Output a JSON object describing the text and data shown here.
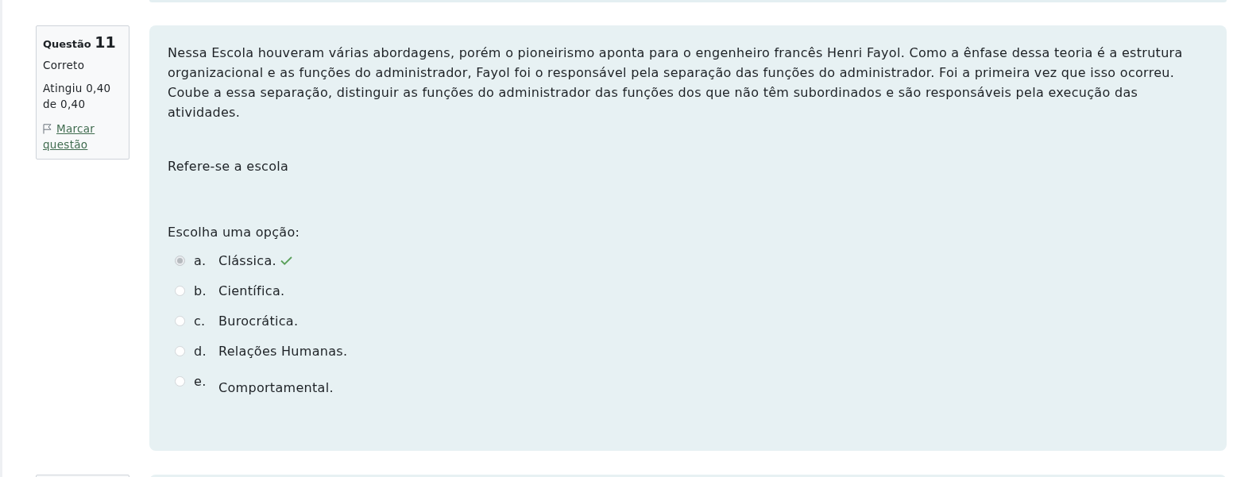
{
  "question": {
    "label": "Questão",
    "number": "11",
    "status": "Correto",
    "grade": "Atingiu 0,40 de 0,40",
    "flag_link": "Marcar questão"
  },
  "question_text": [
    "Nessa Escola houveram várias abordagens, porém o pioneirismo aponta para o engenheiro francês Henri Fayol. Como a ênfase dessa teoria é a estrutura organizacional e as funções do administrador, Fayol foi o responsável pela separação das funções do administrador. Foi a primeira vez que isso ocorreu. Coube a essa separação, distinguir as funções do administrador das funções dos que não têm subordinados e são responsáveis pela execução das atividades.",
    "Refere-se a escola"
  ],
  "prompt": "Escolha uma opção:",
  "options": [
    {
      "letter": "a.",
      "text": "Clássica.",
      "selected": true,
      "correct": true,
      "kind": "inline"
    },
    {
      "letter": "b.",
      "text": "Científica.",
      "selected": false,
      "correct": false,
      "kind": "inline"
    },
    {
      "letter": "c.",
      "text": "Burocrática.",
      "selected": false,
      "correct": false,
      "kind": "inline"
    },
    {
      "letter": "d.",
      "text": "Relações Humanas.",
      "selected": false,
      "correct": false,
      "kind": "inline"
    },
    {
      "letter": "e.",
      "text": "Comportamental.",
      "selected": false,
      "correct": false,
      "kind": "paragraph"
    }
  ]
}
